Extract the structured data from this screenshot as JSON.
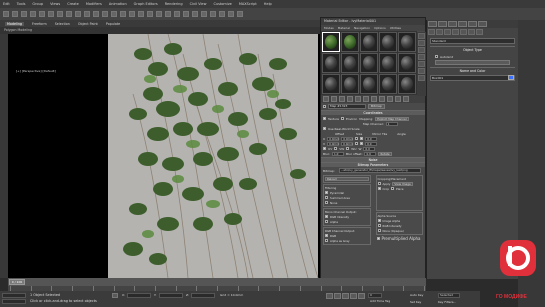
{
  "menubar": {
    "items": [
      "Edit",
      "Tools",
      "Group",
      "Views",
      "Create",
      "Modifiers",
      "Animation",
      "Graph Editors",
      "Rendering",
      "Civil View",
      "Customize",
      "MAXScript",
      "Help"
    ]
  },
  "ribbon": {
    "tabs": [
      "Modeling",
      "Freeform",
      "Selection",
      "Object Paint",
      "Populate"
    ],
    "active": "Modeling",
    "subtitle": "Polygon Modeling"
  },
  "viewport": {
    "label": "[+] [Perspective] [Default]",
    "bg_color": "#b5b3af"
  },
  "material_editor": {
    "title": "Material Editor - IvyMaterial001",
    "menu": [
      "Modes",
      "Material",
      "Navigation",
      "Options",
      "Utilities"
    ],
    "name_value": "IvyMaterial001",
    "type_label": "Map #1323",
    "type_button": "Bitmap",
    "coordinates_header": "Coordinates",
    "texture_label": "Texture",
    "environ_label": "Environ",
    "mapping_label": "Mapping:",
    "mapping_value": "Explicit Map Channel",
    "map_channel_label": "Map Channel:",
    "map_channel_value": "1",
    "use_real_world": "Use Real-World Scale",
    "offset_label": "Offset",
    "size_label": "Size",
    "mirror_tile_label": "Mirror Tile",
    "angle_label": "Angle",
    "u_offset": "0.0mm",
    "v_offset": "0.0mm",
    "u_size": "0.0mm",
    "v_size": "0.0mm",
    "u_angle": "0.0",
    "v_angle": "0.0",
    "w_angle": "0.0",
    "uv_label": "UV",
    "vw_label": "VW",
    "wu_label": "WU",
    "rotate_label": "Rotate",
    "blur_label": "Blur:",
    "blur_value": "1.0",
    "blur_offset_label": "Blur offset:",
    "blur_offset_value": "0.0",
    "noise_header": "Noise",
    "bitmap_header": "Bitmap Parameters",
    "bitmap_label": "Bitmap:",
    "bitmap_path": "...ets\\ivy_generator_ft\\maps\\leaves\\ivy_leaf.png",
    "reload_label": "Reload",
    "cropping_label": "Cropping/Placement",
    "apply_label": "Apply",
    "view_image_label": "View Image",
    "crop_label": "Crop",
    "place_label": "Place",
    "filtering_label": "Filtering",
    "pyramidal_label": "Pyramidal",
    "summed_area_label": "Summed Area",
    "none_label": "None",
    "mono_output_label": "Mono Channel Output:",
    "rgb_intensity_label": "RGB Intensity",
    "alpha_label": "Alpha",
    "rgb_output_label": "RGB Channel Output:",
    "rgb_label": "RGB",
    "alpha_as_gray_label": "Alpha as Gray",
    "alpha_source_label": "Alpha Source",
    "image_alpha_label": "Image Alpha",
    "rgb_intensity2_label": "RGB Intensity",
    "none_opaque_label": "None (Opaque)",
    "premultiplied_label": "Premultiplied Alpha"
  },
  "command_panel": {
    "dropdown": "Standard",
    "object_type": "Object Type",
    "autogrid": "AutoGrid",
    "name_and_color": "Name and Color",
    "object_name": "Box001",
    "swatch_color": "#3b70ff"
  },
  "status": {
    "line1": "1 Object Selected",
    "line2": "Click or click-and-drag to select objects",
    "x_label": "X:",
    "y_label": "Y:",
    "z_label": "Z:",
    "grid": "Grid = 10.0mm",
    "autokey": "Auto Key",
    "selected": "Selected",
    "set_key": "Set Key",
    "key_filters": "Key Filters...",
    "add_time_tag": "Add Time Tag",
    "frame": "0"
  },
  "timeline": {
    "position": "0 / 100",
    "ticks": [
      "0",
      "5",
      "10",
      "15",
      "20",
      "25",
      "30",
      "35",
      "40",
      "45",
      "50",
      "55",
      "60",
      "65",
      "70",
      "75",
      "80",
      "85",
      "90",
      "95",
      "100"
    ]
  },
  "watermark": {
    "text": "ГО МОДИФЕ",
    "color": "#e0303b"
  }
}
